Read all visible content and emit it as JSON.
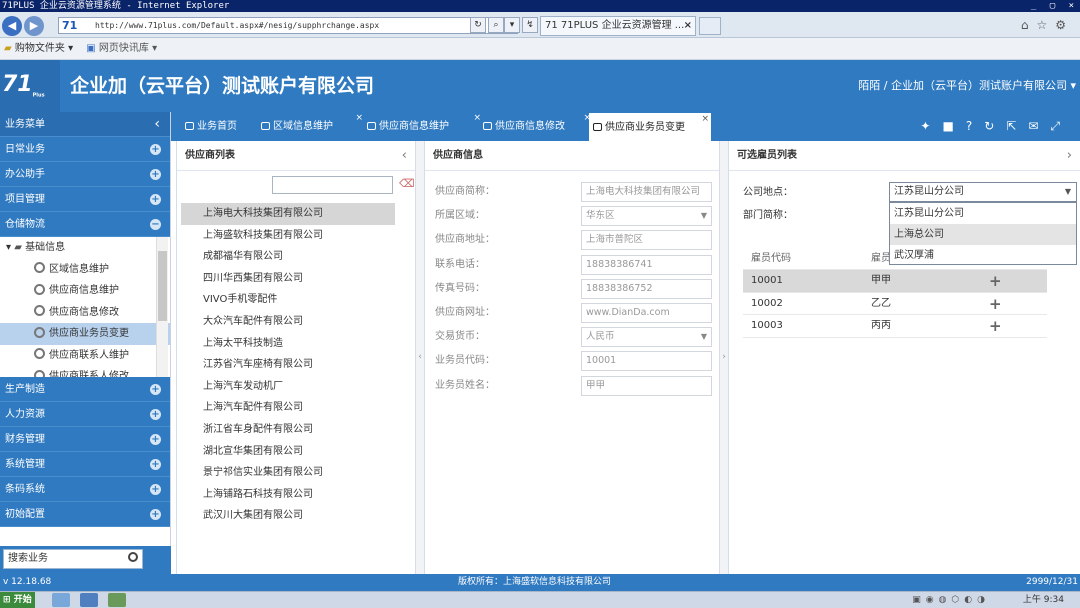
{
  "browser": {
    "title": "71PLUS 企业云资源管理系统 - Internet Explorer",
    "url": "http://www.71plus.com/Default.aspx#/nesig/supphrchange.aspx",
    "url_logo": "71",
    "tab_title": "71 71PLUS 企业云资源管理 ...",
    "tab_close": "×",
    "favorites": "购物文件夹 ▾",
    "quick_sites": "网页快讯库 ▾",
    "window_buttons": "_ ▢ ×"
  },
  "app": {
    "logo": "71",
    "logo_sub": "Plus",
    "company": "企业加（云平台）测试账户有限公司",
    "user": "陌陌 / 企业加（云平台）测试账户有限公司 ▾"
  },
  "sidebar": {
    "title": "业务菜单",
    "collapse": "‹",
    "categories_top": [
      {
        "label": "日常业务",
        "icon": "+"
      },
      {
        "label": "办公助手",
        "icon": "+"
      },
      {
        "label": "项目管理",
        "icon": "+"
      },
      {
        "label": "仓储物流",
        "icon": "−"
      }
    ],
    "tree_root": "基础信息",
    "tree_items": [
      {
        "label": "区域信息维护",
        "selected": false
      },
      {
        "label": "供应商信息维护",
        "selected": false
      },
      {
        "label": "供应商信息修改",
        "selected": false
      },
      {
        "label": "供应商业务员变更",
        "selected": true
      },
      {
        "label": "供应商联系人维护",
        "selected": false
      },
      {
        "label": "供应商联系人修改",
        "selected": false
      }
    ],
    "categories_bottom": [
      {
        "label": "生产制造",
        "icon": "+"
      },
      {
        "label": "人力资源",
        "icon": "+"
      },
      {
        "label": "财务管理",
        "icon": "+"
      },
      {
        "label": "系统管理",
        "icon": "+"
      },
      {
        "label": "条码系统",
        "icon": "+"
      },
      {
        "label": "初始配置",
        "icon": "+"
      }
    ],
    "search_placeholder": "搜索业务"
  },
  "tabs": [
    {
      "label": "业务首页",
      "closable": false,
      "active": false
    },
    {
      "label": "区域信息维护",
      "closable": true,
      "active": false
    },
    {
      "label": "供应商信息维护",
      "closable": true,
      "active": false
    },
    {
      "label": "供应商信息修改",
      "closable": true,
      "active": false
    },
    {
      "label": "供应商业务员变更",
      "closable": true,
      "active": true
    }
  ],
  "supplier_panel": {
    "title": "供应商列表",
    "chevron": "‹",
    "items": [
      {
        "name": "上海电大科技集团有限公司",
        "selected": true
      },
      {
        "name": "上海盛软科技集团有限公司",
        "selected": false
      },
      {
        "name": "成都福华有限公司",
        "selected": false
      },
      {
        "name": "四川华西集团有限公司",
        "selected": false
      },
      {
        "name": "VIVO手机零配件",
        "selected": false
      },
      {
        "name": "大众汽车配件有限公司",
        "selected": false
      },
      {
        "name": "上海太平科技制造",
        "selected": false
      },
      {
        "name": "江苏省汽车座椅有限公司",
        "selected": false
      },
      {
        "name": "上海汽车发动机厂",
        "selected": false
      },
      {
        "name": "上海汽车配件有限公司",
        "selected": false
      },
      {
        "name": "浙江省车身配件有限公司",
        "selected": false
      },
      {
        "name": "湖北宣华集团有限公司",
        "selected": false
      },
      {
        "name": "景宁祁信实业集团有限公司",
        "selected": false
      },
      {
        "name": "上海铺路石科技有限公司",
        "selected": false
      },
      {
        "name": "武汉川大集团有限公司",
        "selected": false
      }
    ]
  },
  "info_panel": {
    "title": "供应商信息",
    "fields": [
      {
        "label": "供应商简称：",
        "value": "上海电大科技集团有限公司",
        "dropdown": false
      },
      {
        "label": "所属区域：",
        "value": "华东区",
        "dropdown": true
      },
      {
        "label": "供应商地址：",
        "value": "上海市普陀区",
        "dropdown": false
      },
      {
        "label": "联系电话：",
        "value": "18838386741",
        "dropdown": false
      },
      {
        "label": "传真号码：",
        "value": "18838386752",
        "dropdown": false
      },
      {
        "label": "供应商网址：",
        "value": "www.DianDa.com",
        "dropdown": false
      },
      {
        "label": "交易货币：",
        "value": "人民币",
        "dropdown": true
      },
      {
        "label": "业务员代码：",
        "value": "10001",
        "dropdown": false
      },
      {
        "label": "业务员姓名：",
        "value": "甲甲",
        "dropdown": false
      }
    ]
  },
  "employee_panel": {
    "title": "可选雇员列表",
    "chevron": "›",
    "location_label": "公司地点：",
    "dept_label": "部门简称：",
    "location_value": "江苏昆山分公司",
    "location_options": [
      "江苏昆山分公司",
      "上海总公司",
      "武汉厚浦"
    ],
    "hovered_option": 1,
    "col_code": "雇员代码",
    "col_name": "雇员",
    "rows": [
      {
        "code": "10001",
        "name": "甲甲",
        "action": "+",
        "selected": true
      },
      {
        "code": "10002",
        "name": "乙乙",
        "action": "+",
        "selected": false
      },
      {
        "code": "10003",
        "name": "丙丙",
        "action": "+",
        "selected": false
      }
    ]
  },
  "footer": {
    "version": "v 12.18.68",
    "copyright": "版权所有：上海盛软信息科技有限公司",
    "date": "2999/12/31"
  },
  "taskbar": {
    "start": "开始",
    "clock": "上午 9:34"
  },
  "colors": {
    "brand_blue": "#2f7ac1",
    "header_dark": "#0a246a",
    "selected_row": "#d6d6d6",
    "tree_selected": "#b8d2ee"
  },
  "icons": [
    "back-icon",
    "forward-icon",
    "refresh-icon",
    "search-icon",
    "home-icon",
    "star-icon",
    "gear-icon",
    "folder-icon",
    "android-icon",
    "video-icon",
    "help-icon",
    "reload-icon",
    "expand-icon",
    "mail-icon",
    "fullscreen-icon",
    "plus-icon",
    "chevron-icon",
    "close-icon"
  ]
}
